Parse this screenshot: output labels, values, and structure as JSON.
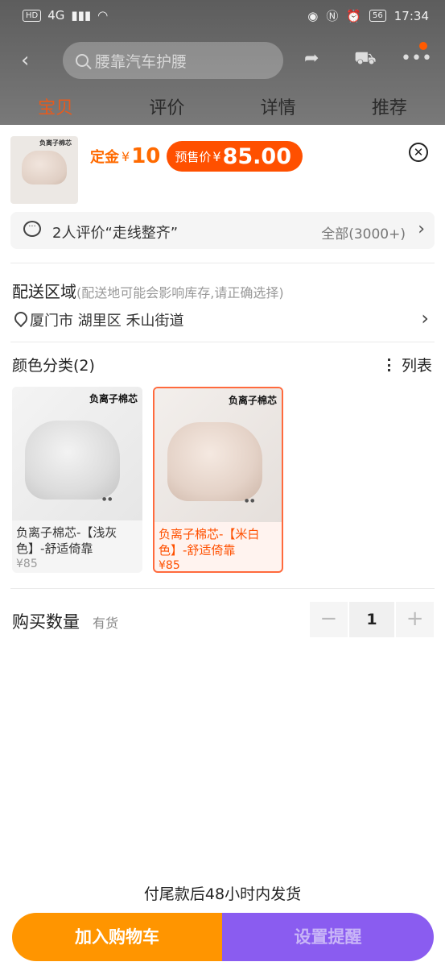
{
  "status_bar": {
    "left_hd": "HD",
    "left_net": "4G",
    "battery": "56",
    "time": "17:34"
  },
  "top_bar": {
    "search_placeholder": "腰靠汽车护腰"
  },
  "tabs": [
    {
      "label": "宝贝",
      "active": true
    },
    {
      "label": "评价",
      "active": false
    },
    {
      "label": "详情",
      "active": false
    },
    {
      "label": "推荐",
      "active": false
    }
  ],
  "product": {
    "thumb_title": "负离子棉芯",
    "deposit_label": "定金",
    "currency": "¥",
    "deposit_value": "10",
    "presale_label": "预售价",
    "presale_value": "85.00"
  },
  "review": {
    "text": "2人评价“走线整齐”",
    "all_label": "全部(3000+)"
  },
  "delivery": {
    "title": "配送区域",
    "note": "(配送地可能会影响库存,请正确选择)",
    "address": "厦门市 湖里区 禾山街道"
  },
  "color": {
    "title": "颜色分类(2)",
    "list_toggle": "列表",
    "options": [
      {
        "badge": "负离子棉芯",
        "name": "负离子棉芯-【浅灰色】-舒适倚靠",
        "price": "¥85",
        "selected": false
      },
      {
        "badge": "负离子棉芯",
        "name": "负离子棉芯-【米白色】-舒适倚靠",
        "price": "¥85",
        "selected": true
      }
    ]
  },
  "quantity": {
    "label": "购买数量",
    "stock": "有货",
    "minus": "−",
    "value": "1",
    "plus": "+"
  },
  "footer": {
    "ship_note": "付尾款后48小时内发货",
    "add_to_cart": "加入购物车",
    "set_reminder": "设置提醒"
  },
  "colors": {
    "accent_orange": "#ff5000",
    "cart_button": "#ff9500",
    "reminder_button": "#8a5cf0"
  }
}
